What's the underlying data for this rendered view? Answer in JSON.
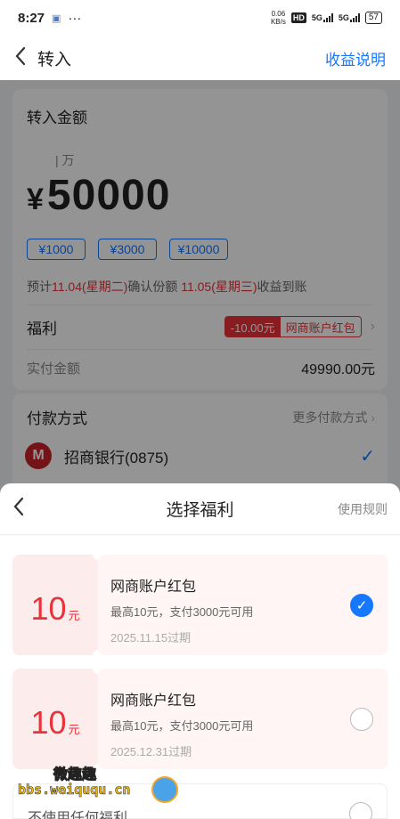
{
  "status_bar": {
    "time": "8:27",
    "net_speed_value": "0.06",
    "net_speed_unit": "KB/s",
    "hd": "HD",
    "signal1": "5G",
    "signal2": "5G",
    "battery": "57"
  },
  "nav": {
    "title": "转入",
    "right_link": "收益说明"
  },
  "amount_card": {
    "label": "转入金额",
    "unit_hint": "万",
    "currency": "¥",
    "amount": "50000",
    "chips": [
      "¥1000",
      "¥3000",
      "¥10000"
    ],
    "est_prefix": "预计",
    "est_date1": "11.04(星期二)",
    "est_mid": "确认份额 ",
    "est_date2": "11.05(星期三)",
    "est_suffix": "收益到账",
    "benefit_label": "福利",
    "benefit_discount": "-10.00元",
    "benefit_name": "网商账户红包",
    "paid_label": "实付金额",
    "paid_value": "49990.00元"
  },
  "pay_card": {
    "label": "付款方式",
    "more": "更多付款方式",
    "bank": "招商银行(0875)"
  },
  "sheet": {
    "title": "选择福利",
    "rules": "使用规则",
    "coupons": [
      {
        "value": "10",
        "unit": "元",
        "name": "网商账户红包",
        "desc": "最高10元，支付3000元可用",
        "expiry": "2025.11.15过期",
        "selected": true
      },
      {
        "value": "10",
        "unit": "元",
        "name": "网商账户红包",
        "desc": "最高10元，支付3000元可用",
        "expiry": "2025.12.31过期",
        "selected": false
      }
    ],
    "no_benefit": "不使用任何福利"
  },
  "watermark": {
    "title": "微趣趣",
    "url": "bbs.weiququ.cn"
  },
  "colors": {
    "accent": "#1677ff",
    "red": "#e8333a",
    "coupon_bg": "#fdecec"
  }
}
